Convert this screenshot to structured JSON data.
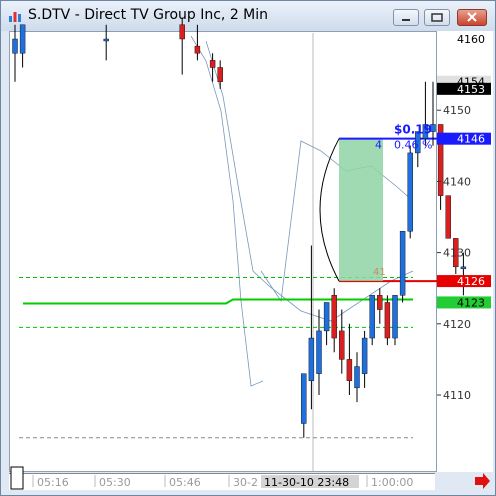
{
  "window": {
    "title": "S.DTV - Direct TV Group Inc, 2 Min",
    "icon": "chart-app-icon",
    "buttons": [
      "minimize-icon",
      "restore-icon",
      "close-icon"
    ]
  },
  "chart_data": {
    "type": "candlestick",
    "title": "S.DTV - Direct TV Group Inc, 2 Min",
    "y_axis": {
      "ticks": [
        4110,
        4120,
        4130,
        4140,
        4150,
        4160
      ],
      "range": [
        4100,
        4163
      ]
    },
    "x_axis": {
      "ticks": [
        "05:16",
        "05:30",
        "05:46",
        "30-2",
        "1:00:00"
      ],
      "cursor_label": "11-30-10  23:48"
    },
    "price_tags": [
      {
        "text": "4160",
        "value": 4160,
        "bg": "#ffffff",
        "fg": "#000000"
      },
      {
        "text": "4154",
        "value": 4154,
        "bg": "#e0e0e0",
        "fg": "#000000"
      },
      {
        "text": "4153",
        "value": 4153,
        "bg": "#000000",
        "fg": "#ffffff"
      },
      {
        "text": "4146",
        "value": 4146,
        "bg": "#1a1aff",
        "fg": "#ffffff"
      },
      {
        "text": "4126",
        "value": 4126,
        "bg": "#e60000",
        "fg": "#ffffff"
      },
      {
        "text": "4123",
        "value": 4123,
        "bg": "#22cc33",
        "fg": "#000000"
      }
    ],
    "measure": {
      "change": "$0.19",
      "percent": "0.46 %",
      "bars_top": "4",
      "bars_bottom": "41",
      "from_price": 4126,
      "to_price": 4146
    },
    "levels": [
      {
        "value": 4126.5,
        "color": "#00c000",
        "style": "dashed"
      },
      {
        "value": 4123,
        "color": "#00cc00",
        "style": "solid"
      },
      {
        "value": 4119.5,
        "color": "#00c000",
        "style": "dashed"
      },
      {
        "value": 4126,
        "color": "#e60000",
        "style": "solid"
      },
      {
        "value": 4104,
        "color": "#888888",
        "style": "dashed"
      }
    ],
    "candles": [
      {
        "o": 4158,
        "h": 4162,
        "l": 4154,
        "c": 4160
      },
      {
        "o": 4158,
        "h": 4162,
        "l": 4156,
        "c": 4162
      },
      {
        "o": 4160,
        "h": 4162,
        "l": 4157,
        "c": 4160
      },
      {
        "o": 4162,
        "h": 4163,
        "l": 4155,
        "c": 4160
      },
      {
        "o": 4159,
        "h": 4162,
        "l": 4157,
        "c": 4158
      },
      {
        "o": 4157,
        "h": 4158,
        "l": 4154,
        "c": 4156
      },
      {
        "o": 4156,
        "h": 4157,
        "l": 4153,
        "c": 4154
      },
      {
        "o": 4106,
        "h": 4108,
        "l": 4104,
        "c": 4113
      },
      {
        "o": 4112,
        "h": 4131,
        "l": 4108,
        "c": 4118
      },
      {
        "o": 4113,
        "h": 4122,
        "l": 4110,
        "c": 4119
      },
      {
        "o": 4119,
        "h": 4123,
        "l": 4117,
        "c": 4123
      },
      {
        "o": 4124,
        "h": 4125,
        "l": 4116,
        "c": 4118
      },
      {
        "o": 4119,
        "h": 4122,
        "l": 4113,
        "c": 4115
      },
      {
        "o": 4115,
        "h": 4120,
        "l": 4110,
        "c": 4112
      },
      {
        "o": 4111,
        "h": 4116,
        "l": 4109,
        "c": 4114
      },
      {
        "o": 4113,
        "h": 4119,
        "l": 4111,
        "c": 4118
      },
      {
        "o": 4118,
        "h": 4124,
        "l": 4117,
        "c": 4124
      },
      {
        "o": 4124,
        "h": 4125,
        "l": 4120,
        "c": 4122
      },
      {
        "o": 4123,
        "h": 4124,
        "l": 4117,
        "c": 4118
      },
      {
        "o": 4118,
        "h": 4124,
        "l": 4117,
        "c": 4124
      },
      {
        "o": 4124,
        "h": 4133,
        "l": 4123,
        "c": 4133
      },
      {
        "o": 4133,
        "h": 4145,
        "l": 4132,
        "c": 4144
      },
      {
        "o": 4144,
        "h": 4147,
        "l": 4142,
        "c": 4147
      },
      {
        "o": 4146,
        "h": 4154,
        "l": 4145,
        "c": 4148
      },
      {
        "o": 4147,
        "h": 4154,
        "l": 4145,
        "c": 4148
      },
      {
        "o": 4148,
        "h": 4148,
        "l": 4136,
        "c": 4138
      },
      {
        "o": 4138,
        "h": 4138,
        "l": 4132,
        "c": 4132
      },
      {
        "o": 4132,
        "h": 4132,
        "l": 4127,
        "c": 4128
      },
      {
        "o": 4128,
        "h": 4130,
        "l": 4124,
        "c": 4128
      }
    ],
    "colors": {
      "up": "#1f6fdc",
      "down": "#d92020"
    }
  },
  "status": {
    "arrow_icon": "right-arrow-icon"
  }
}
